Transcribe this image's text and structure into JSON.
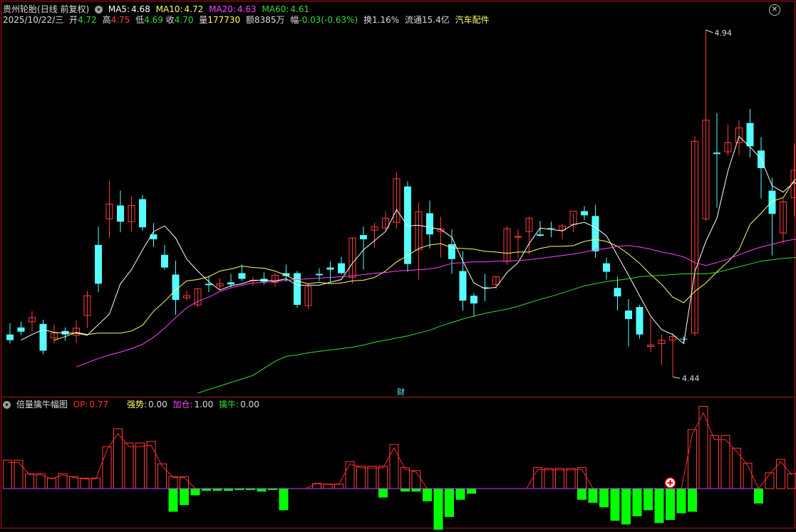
{
  "stock": {
    "name": "贵州轮胎",
    "mode": "(日线 前复权)",
    "ma": [
      {
        "label": "MA5:",
        "value": "4.68",
        "color": "#ffffff"
      },
      {
        "label": "MA10:",
        "value": "4.72",
        "color": "#ffff66"
      },
      {
        "label": "MA20:",
        "value": "4.63",
        "color": "#ff44ff"
      },
      {
        "label": "MA60:",
        "value": "4.61",
        "color": "#33dd33"
      }
    ]
  },
  "quote": {
    "date": "2025/10/22/三",
    "open_label": "开",
    "open": "4.72",
    "high_label": "高",
    "high": "4.75",
    "low_label": "低",
    "low": "4.69",
    "close_label": "收",
    "close": "4.70",
    "vol_label": "量",
    "vol": "177730",
    "amt_label": "额",
    "amt": "8385万",
    "chg_label": "幅",
    "chg": "-0.03(-0.63%)",
    "turnover": "换1.16%",
    "float": "流通15.4亿",
    "sector": "汽车配件"
  },
  "markers": {
    "high": "4.94",
    "low": "4.44",
    "finance": "财"
  },
  "indicator": {
    "name": "倍量擒牛幅图",
    "items": [
      {
        "label": "OP:",
        "value": "0.77",
        "color": "#ff3333"
      },
      {
        "label": "强势:",
        "value": "0.00",
        "color": "#ffff66"
      },
      {
        "label": "加仓:",
        "value": "1.00",
        "color": "#ff44ff"
      },
      {
        "label": "擒牛:",
        "value": "0.00",
        "color": "#33dd33"
      }
    ]
  },
  "colors": {
    "up": "#ff3b3b",
    "down": "#54ffff",
    "frame": "#b01616",
    "bull": "#00ff00",
    "strong": "#ffff00"
  },
  "chart_data": {
    "type": "candlestick",
    "price_range": [
      4.44,
      4.94
    ],
    "candles": [
      [
        4.508,
        4.524,
        4.495,
        4.5
      ],
      [
        4.518,
        4.526,
        4.507,
        4.512
      ],
      [
        4.526,
        4.541,
        4.513,
        4.532
      ],
      [
        4.523,
        4.529,
        4.48,
        4.485
      ],
      [
        4.503,
        4.522,
        4.495,
        4.51
      ],
      [
        4.513,
        4.518,
        4.499,
        4.508
      ],
      [
        4.507,
        4.528,
        4.496,
        4.517
      ],
      [
        4.535,
        4.57,
        4.517,
        4.563
      ],
      [
        4.635,
        4.661,
        4.568,
        4.58
      ],
      [
        4.672,
        4.726,
        4.645,
        4.693
      ],
      [
        4.691,
        4.712,
        4.653,
        4.668
      ],
      [
        4.668,
        4.704,
        4.654,
        4.691
      ],
      [
        4.7,
        4.706,
        4.655,
        4.66
      ],
      [
        4.65,
        4.666,
        4.632,
        4.643
      ],
      [
        4.621,
        4.635,
        4.6,
        4.603
      ],
      [
        4.593,
        4.613,
        4.536,
        4.557
      ],
      [
        4.56,
        4.57,
        4.556,
        4.563
      ],
      [
        4.55,
        4.574,
        4.547,
        4.573
      ],
      [
        4.58,
        4.591,
        4.568,
        4.578
      ],
      [
        4.577,
        4.588,
        4.572,
        4.58
      ],
      [
        4.582,
        4.594,
        4.575,
        4.579
      ],
      [
        4.595,
        4.607,
        4.584,
        4.587
      ],
      [
        4.585,
        4.59,
        4.577,
        4.585
      ],
      [
        4.587,
        4.596,
        4.579,
        4.583
      ],
      [
        4.582,
        4.595,
        4.576,
        4.592
      ],
      [
        4.595,
        4.607,
        4.583,
        4.591
      ],
      [
        4.595,
        4.598,
        4.546,
        4.55
      ],
      [
        4.549,
        4.581,
        4.544,
        4.576
      ],
      [
        4.594,
        4.602,
        4.584,
        4.592
      ],
      [
        4.603,
        4.612,
        4.583,
        4.6
      ],
      [
        4.609,
        4.618,
        4.593,
        4.595
      ],
      [
        4.589,
        4.646,
        4.58,
        4.645
      ],
      [
        4.649,
        4.661,
        4.6,
        4.643
      ],
      [
        4.656,
        4.666,
        4.631,
        4.661
      ],
      [
        4.659,
        4.683,
        4.655,
        4.673
      ],
      [
        4.667,
        4.738,
        4.658,
        4.729
      ],
      [
        4.718,
        4.725,
        4.597,
        4.608
      ],
      [
        4.628,
        4.695,
        4.586,
        4.682
      ],
      [
        4.68,
        4.698,
        4.63,
        4.65
      ],
      [
        4.654,
        4.675,
        4.617,
        4.658
      ],
      [
        4.636,
        4.657,
        4.594,
        4.615
      ],
      [
        4.598,
        4.626,
        4.542,
        4.556
      ],
      [
        4.563,
        4.567,
        4.533,
        4.552
      ],
      [
        4.575,
        4.594,
        4.555,
        4.574
      ],
      [
        4.579,
        4.59,
        4.572,
        4.59
      ],
      [
        4.612,
        4.662,
        4.607,
        4.658
      ],
      [
        4.646,
        4.657,
        4.616,
        4.647
      ],
      [
        4.654,
        4.675,
        4.622,
        4.673
      ],
      [
        4.65,
        4.669,
        4.647,
        4.648
      ],
      [
        4.659,
        4.668,
        4.646,
        4.658
      ],
      [
        4.656,
        4.665,
        4.643,
        4.662
      ],
      [
        4.664,
        4.68,
        4.653,
        4.683
      ],
      [
        4.683,
        4.69,
        4.67,
        4.677
      ],
      [
        4.676,
        4.692,
        4.617,
        4.626
      ],
      [
        4.609,
        4.617,
        4.586,
        4.597
      ],
      [
        4.574,
        4.59,
        4.542,
        4.562
      ],
      [
        4.542,
        4.558,
        4.491,
        4.53
      ],
      [
        4.547,
        4.55,
        4.502,
        4.508
      ],
      [
        4.491,
        4.532,
        4.483,
        4.493
      ],
      [
        4.495,
        4.508,
        4.465,
        4.5
      ],
      [
        4.5,
        4.51,
        4.448,
        4.505
      ],
      [
        4.502,
        4.505,
        4.495,
        4.501
      ],
      [
        4.51,
        4.789,
        4.506,
        4.782
      ],
      [
        4.672,
        4.94,
        4.669,
        4.812
      ],
      [
        4.766,
        4.822,
        4.688,
        4.764
      ],
      [
        4.767,
        4.806,
        4.762,
        4.78
      ],
      [
        4.78,
        4.812,
        4.762,
        4.801
      ],
      [
        4.808,
        4.828,
        4.759,
        4.775
      ],
      [
        4.769,
        4.788,
        4.701,
        4.744
      ],
      [
        4.712,
        4.73,
        4.62,
        4.679
      ],
      [
        4.652,
        4.701,
        4.636,
        4.696
      ],
      [
        4.702,
        4.779,
        4.675,
        4.741
      ],
      [
        4.724,
        4.75,
        4.727,
        4.705
      ]
    ],
    "ma_series": [
      {
        "name": "MA5",
        "values": [
          4.5,
          4.508,
          4.515,
          4.511,
          4.51,
          4.51,
          4.507,
          4.522,
          4.537,
          4.58,
          4.6,
          4.628,
          4.654,
          4.662,
          4.645,
          4.615,
          4.598,
          4.583,
          4.571,
          4.577,
          4.58,
          4.585,
          4.585,
          4.584,
          4.587,
          4.578,
          4.578,
          4.578,
          4.582,
          4.586,
          4.609,
          4.628,
          4.641,
          4.654,
          4.685,
          4.662,
          4.663,
          4.66,
          4.657,
          4.646,
          4.612,
          4.581,
          4.573,
          4.575,
          4.596,
          4.61,
          4.637,
          4.659,
          4.657,
          4.655,
          4.664,
          4.667,
          4.66,
          4.648,
          4.62,
          4.592,
          4.563,
          4.534,
          4.515,
          4.508,
          4.495,
          4.597,
          4.64,
          4.673,
          4.74,
          4.789,
          4.774,
          4.757,
          4.719,
          4.71,
          4.724,
          4.713
        ]
      },
      {
        "name": "MA10",
        "values": [
          4.5,
          4.505,
          4.511,
          4.508,
          4.51,
          4.51,
          4.51,
          4.513,
          4.521,
          4.541,
          4.555,
          4.571,
          4.584,
          4.586,
          4.59,
          4.598,
          4.601,
          4.605,
          4.603,
          4.602,
          4.598,
          4.592,
          4.584,
          4.58,
          4.582,
          4.58,
          4.581,
          4.584,
          4.585,
          4.589,
          4.598,
          4.611,
          4.62,
          4.63,
          4.635,
          4.637,
          4.631,
          4.63,
          4.629,
          4.626,
          4.625,
          4.623,
          4.625,
          4.625,
          4.63,
          4.633,
          4.633,
          4.634,
          4.64,
          4.643,
          4.64,
          4.633,
          4.622,
          4.609,
          4.593,
          4.579,
          4.561,
          4.553,
          4.569,
          4.581,
          4.597,
          4.611,
          4.628,
          4.664,
          4.68,
          4.697,
          4.702,
          4.727,
          4.73
        ]
      },
      {
        "name": "MA20",
        "values": [
          4.462,
          4.468,
          4.474,
          4.479,
          4.483,
          4.488,
          4.494,
          4.504,
          4.517,
          4.532,
          4.546,
          4.555,
          4.561,
          4.569,
          4.574,
          4.578,
          4.581,
          4.582,
          4.583,
          4.585,
          4.586,
          4.587,
          4.588,
          4.589,
          4.59,
          4.591,
          4.593,
          4.595,
          4.596,
          4.598,
          4.599,
          4.6,
          4.601,
          4.604,
          4.609,
          4.61,
          4.611,
          4.611,
          4.612,
          4.612,
          4.613,
          4.614,
          4.616,
          4.618,
          4.62,
          4.622,
          4.625,
          4.628,
          4.63,
          4.633,
          4.634,
          4.632,
          4.629,
          4.625,
          4.622,
          4.618,
          4.61,
          4.606,
          4.61,
          4.615,
          4.621,
          4.627,
          4.632,
          4.636,
          4.64,
          4.643,
          4.645
        ]
      },
      {
        "name": "MA60",
        "values": [
          4.425,
          4.43,
          4.435,
          4.44,
          4.445,
          4.45,
          4.46,
          4.47,
          4.477,
          4.479,
          4.482,
          4.484,
          4.486,
          4.488,
          4.49,
          4.493,
          4.497,
          4.5,
          4.503,
          4.506,
          4.51,
          4.514,
          4.52,
          4.525,
          4.53,
          4.534,
          4.538,
          4.541,
          4.544,
          4.548,
          4.553,
          4.558,
          4.562,
          4.567,
          4.572,
          4.577,
          4.58,
          4.583,
          4.585,
          4.587,
          4.59,
          4.591,
          4.592,
          4.593,
          4.594,
          4.594,
          4.594,
          4.596,
          4.6,
          4.604,
          4.608,
          4.612,
          4.614,
          4.616,
          4.617,
          4.617
        ]
      }
    ],
    "indicator_bars": [
      {
        "red": [
          0.38,
          0.38,
          0.2,
          0.2,
          0.14,
          0.2,
          0.16,
          0.14,
          0.14,
          0.56,
          0.8,
          0.61,
          0.61,
          0.63,
          0.33,
          0.16,
          0.16,
          0,
          0,
          0,
          0,
          0,
          0,
          0,
          0,
          0,
          0,
          0,
          0.07,
          0.06,
          0.06,
          0.36,
          0.3,
          0.3,
          0.3,
          0.59,
          0.28,
          0.24,
          0,
          0,
          0,
          0,
          0,
          0,
          0,
          0,
          0,
          0,
          0.28,
          0.27,
          0.27,
          0.27,
          0.28,
          0,
          0,
          0,
          0,
          0,
          0,
          0,
          0,
          0,
          0.79,
          1.1,
          0.71,
          0.71,
          0.54,
          0.34,
          0,
          0.21,
          0.39,
          0.2
        ]
      },
      {
        "green": [
          0,
          0,
          0,
          0,
          0,
          0,
          0,
          0,
          0,
          0,
          0,
          0,
          0,
          0,
          0,
          -0.31,
          -0.22,
          -0.09,
          -0.03,
          -0.03,
          -0.03,
          -0.02,
          -0.02,
          -0.04,
          -0.02,
          -0.29,
          0,
          0,
          0,
          0,
          0,
          0,
          0,
          0,
          -0.12,
          0,
          -0.04,
          -0.04,
          -0.17,
          -0.55,
          -0.38,
          -0.15,
          -0.07,
          0,
          0,
          0,
          0,
          0,
          0,
          0,
          0,
          0,
          -0.15,
          -0.19,
          -0.25,
          -0.43,
          -0.48,
          -0.37,
          -0.29,
          -0.46,
          -0.42,
          -0.33,
          -0.31,
          0,
          0,
          0,
          0,
          0,
          -0.2,
          0,
          0,
          0
        ]
      },
      {
        "strong_index": 60
      }
    ]
  }
}
